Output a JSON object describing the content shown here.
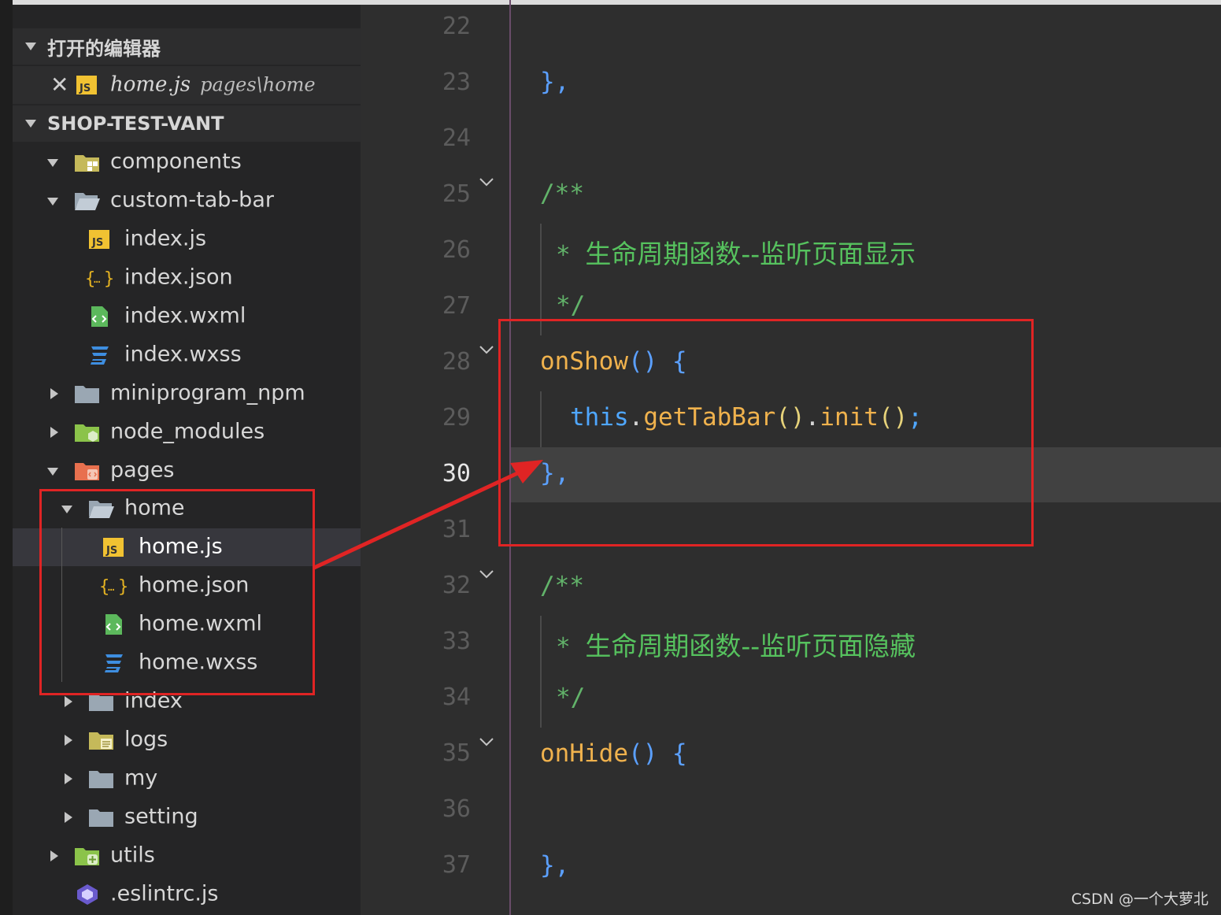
{
  "sidebar": {
    "open_editors_header": "打开的编辑器",
    "open_editor": {
      "file": "home.js",
      "path": "pages\\home"
    },
    "project_header": "SHOP-TEST-VANT",
    "tree": [
      {
        "label": "components",
        "icon": "components-folder-icon"
      },
      {
        "label": "custom-tab-bar",
        "icon": "folder-open-icon"
      },
      {
        "label": "index.js",
        "icon": "js-file-icon"
      },
      {
        "label": "index.json",
        "icon": "json-file-icon"
      },
      {
        "label": "index.wxml",
        "icon": "wxml-file-icon"
      },
      {
        "label": "index.wxss",
        "icon": "css-file-icon"
      },
      {
        "label": "miniprogram_npm",
        "icon": "folder-icon"
      },
      {
        "label": "node_modules",
        "icon": "node-folder-icon"
      },
      {
        "label": "pages",
        "icon": "pages-folder-icon"
      },
      {
        "label": "home",
        "icon": "folder-open-icon"
      },
      {
        "label": "home.js",
        "icon": "js-file-icon"
      },
      {
        "label": "home.json",
        "icon": "json-file-icon"
      },
      {
        "label": "home.wxml",
        "icon": "wxml-file-icon"
      },
      {
        "label": "home.wxss",
        "icon": "css-file-icon"
      },
      {
        "label": "index",
        "icon": "folder-icon"
      },
      {
        "label": "logs",
        "icon": "logs-folder-icon"
      },
      {
        "label": "my",
        "icon": "folder-icon"
      },
      {
        "label": "setting",
        "icon": "folder-icon"
      },
      {
        "label": "utils",
        "icon": "utils-folder-icon"
      },
      {
        "label": ".eslintrc.js",
        "icon": "eslint-file-icon"
      }
    ]
  },
  "editor": {
    "current_line": 30,
    "lines": [
      {
        "n": "22"
      },
      {
        "n": "23"
      },
      {
        "n": "24"
      },
      {
        "n": "25"
      },
      {
        "n": "26"
      },
      {
        "n": "27"
      },
      {
        "n": "28"
      },
      {
        "n": "29"
      },
      {
        "n": "30"
      },
      {
        "n": "31"
      },
      {
        "n": "32"
      },
      {
        "n": "33"
      },
      {
        "n": "34"
      },
      {
        "n": "35"
      },
      {
        "n": "36"
      },
      {
        "n": "37"
      }
    ],
    "code": {
      "l23": "},",
      "l25": "/**",
      "l26_star": "* ",
      "l26_text": "生命周期函数--监听页面显示",
      "l27": "*/",
      "l28_fn": "onShow",
      "l28_paren": "()",
      "l28_brace": " {",
      "l29_this": "this",
      "l29_dot1": ".",
      "l29_fn": "getTabBar",
      "l29_p1": "()",
      "l29_dot2": ".",
      "l29_init": "init",
      "l29_p2": "()",
      "l29_semi": ";",
      "l30": "},",
      "l32": "/**",
      "l33_star": "* ",
      "l33_text": "生命周期函数--监听页面隐藏",
      "l34": "*/",
      "l35_fn": "onHide",
      "l35_paren": "()",
      "l35_brace": " {",
      "l37": "},"
    }
  },
  "watermark": "CSDN @一个大萝北",
  "colors": {
    "highlight_box": "#e02424",
    "keyword_fn": "#f0b24d",
    "comment": "#62b36a",
    "brace": "#5ba0ff"
  }
}
